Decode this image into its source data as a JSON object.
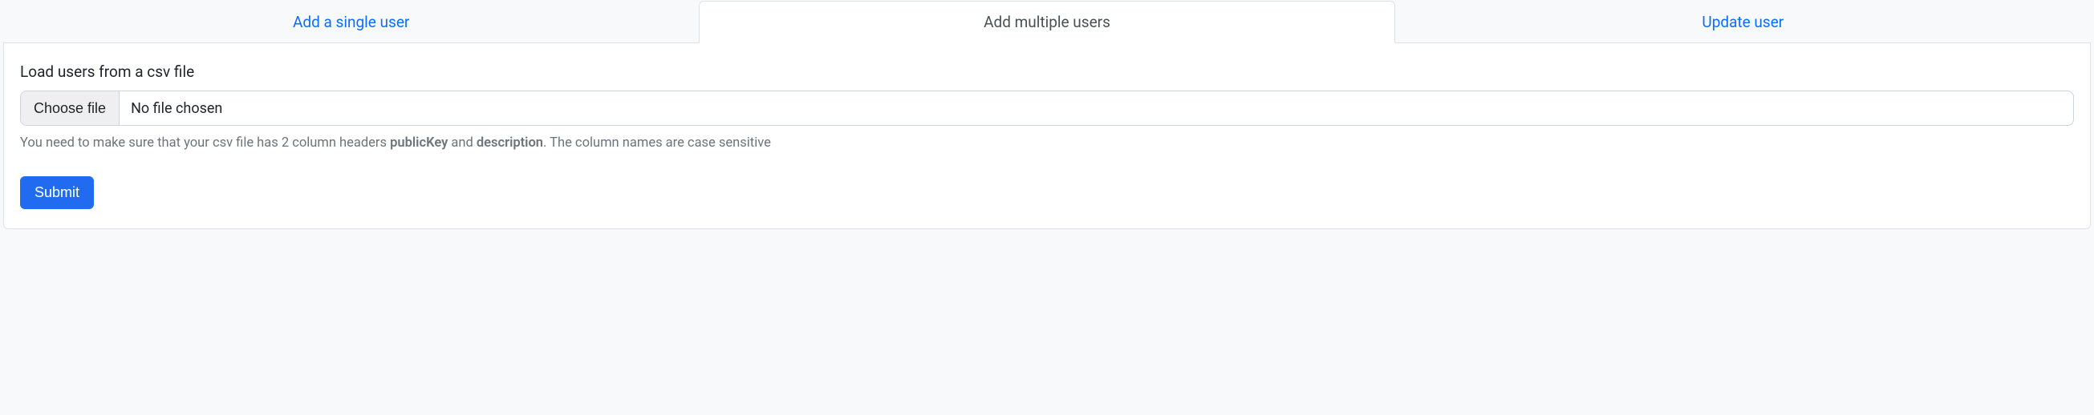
{
  "tabs": {
    "single": {
      "label": "Add a single user",
      "active": false
    },
    "multiple": {
      "label": "Add multiple users",
      "active": true
    },
    "update": {
      "label": "Update user",
      "active": false
    }
  },
  "form": {
    "label": "Load users from a csv file",
    "file_button_label": "Choose file",
    "file_status": "No file chosen",
    "help_prefix": "You need to make sure that your csv file has 2 column headers ",
    "help_col1": "publicKey",
    "help_and": " and ",
    "help_col2": "description",
    "help_suffix": ". The column names are case sensitive",
    "submit_label": "Submit"
  }
}
